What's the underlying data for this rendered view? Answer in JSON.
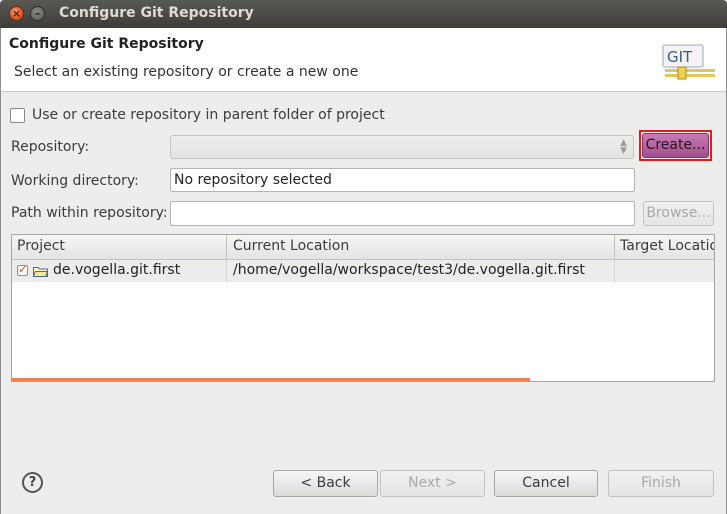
{
  "window": {
    "title": "Configure Git Repository",
    "close_glyph": "×",
    "minimize_glyph": "–"
  },
  "header": {
    "title": "Configure Git Repository",
    "subtitle": "Select an existing repository or create a new one",
    "logo_text": "GIT"
  },
  "form": {
    "parent_folder_checkbox": {
      "label": "Use or create repository in parent folder of project",
      "checked": false
    },
    "repository": {
      "label": "Repository:",
      "value": ""
    },
    "create_button": "Create...",
    "working_directory": {
      "label": "Working directory:",
      "value": "No repository selected"
    },
    "path_within_repository": {
      "label": "Path within repository:",
      "value": ""
    },
    "browse_button": "Browse..."
  },
  "table": {
    "columns": [
      "Project",
      "Current Location",
      "Target Location"
    ],
    "rows": [
      {
        "project": "de.vogella.git.first",
        "current_location": "/home/vogella/workspace/test3/de.vogella.git.first",
        "target_location": "",
        "checked": true
      }
    ]
  },
  "footer": {
    "help_glyph": "?",
    "back": "< Back",
    "next": "Next >",
    "cancel": "Cancel",
    "finish": "Finish"
  },
  "colors": {
    "title_bar": "#3d3c38",
    "create_button": "#a0508c",
    "highlight_border": "#e01b1b",
    "scroll_indicator": "#f08050"
  },
  "icons": [
    "close-icon",
    "minimize-icon",
    "git-logo-icon",
    "help-icon",
    "folder-icon",
    "dropdown-arrow-icon"
  ]
}
